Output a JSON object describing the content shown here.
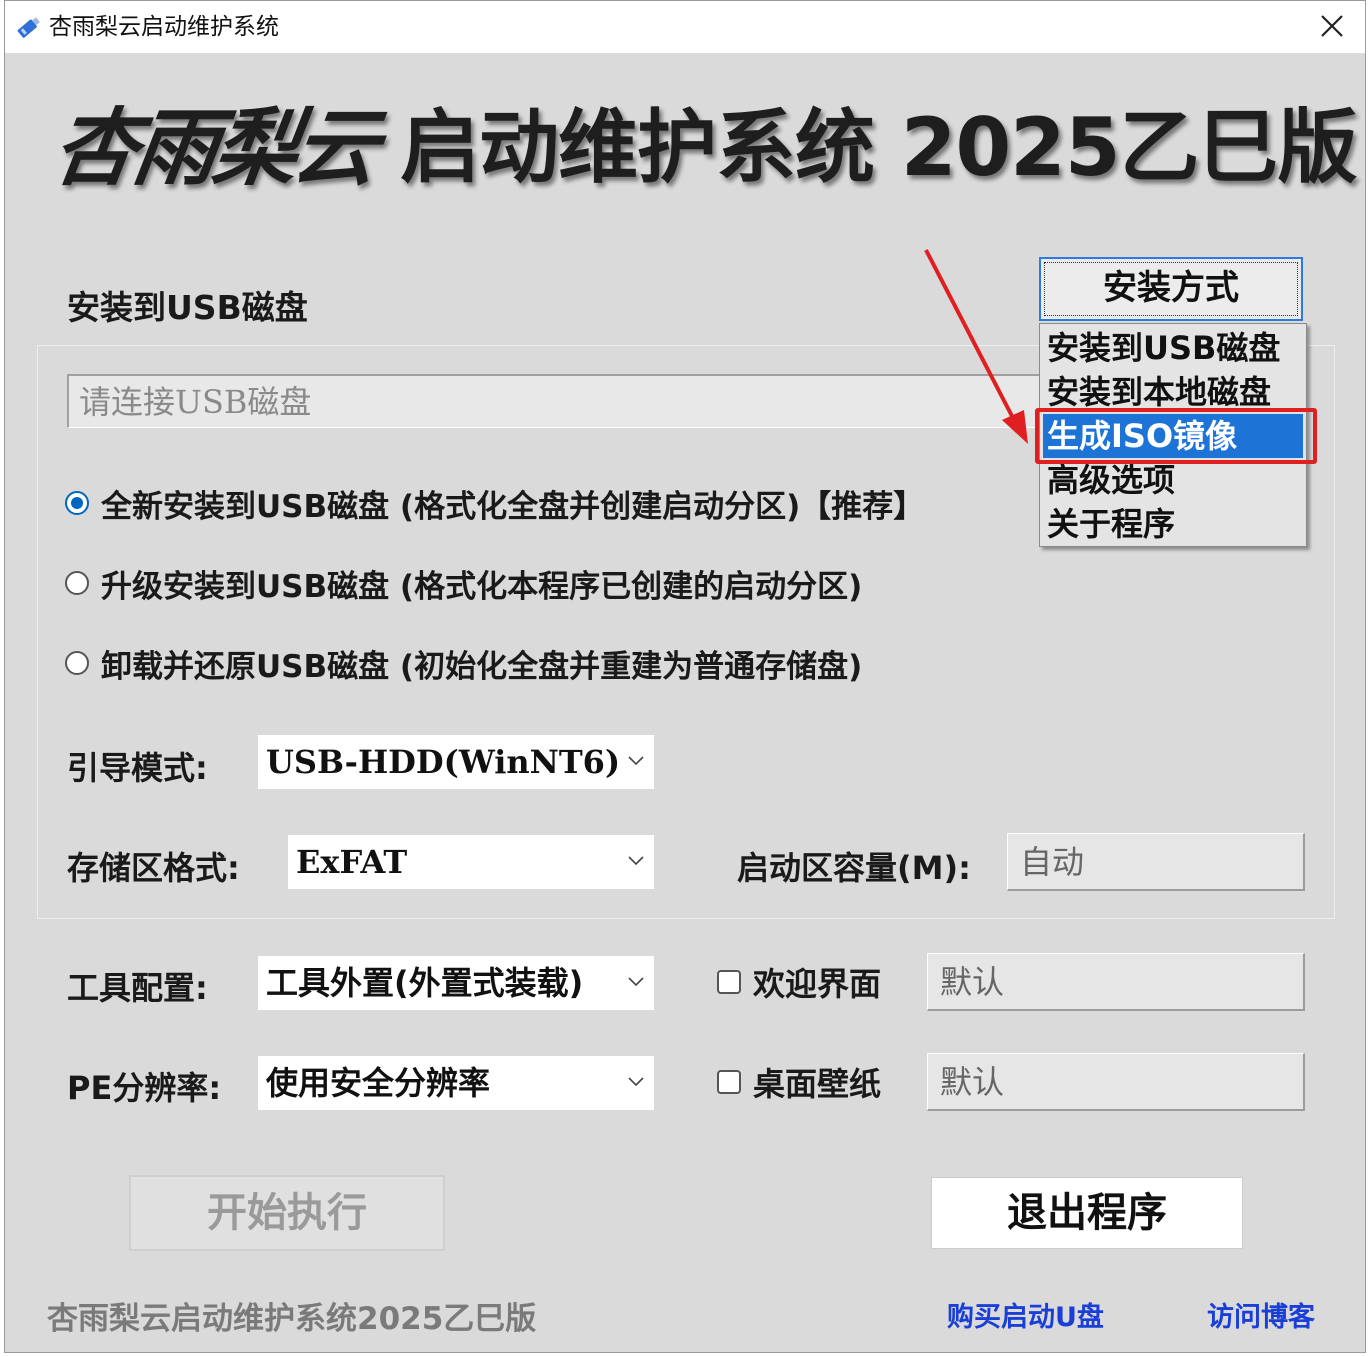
{
  "window": {
    "title": "杏雨梨云启动维护系统",
    "icon": "usb-drive-icon"
  },
  "banner": {
    "script_text": "杏雨梨云",
    "main_text": "启动维护系统 2025乙巳版"
  },
  "install_section": {
    "title": "安装到USB磁盘",
    "usb_placeholder": "请连接USB磁盘",
    "options": [
      {
        "label": "全新安装到USB磁盘 (格式化全盘并创建启动分区)【推荐】",
        "checked": true
      },
      {
        "label": "升级安装到USB磁盘 (格式化本程序已创建的启动分区)",
        "checked": false
      },
      {
        "label": "卸载并还原USB磁盘 (初始化全盘并重建为普通存储盘)",
        "checked": false
      }
    ],
    "boot_mode": {
      "label": "引导模式:",
      "value": "USB-HDD(WinNT6)"
    },
    "storage_format": {
      "label": "存储区格式:",
      "value": "ExFAT"
    },
    "boot_size": {
      "label": "启动区容量(M):",
      "value": "自动"
    }
  },
  "tools": {
    "label": "工具配置:",
    "value": "工具外置(外置式装载)",
    "welcome": {
      "label": "欢迎界面",
      "checked": false,
      "value": "默认"
    }
  },
  "pe_resolution": {
    "label": "PE分辨率:",
    "value": "使用安全分辨率",
    "wallpaper": {
      "label": "桌面壁纸",
      "checked": false,
      "value": "默认"
    }
  },
  "buttons": {
    "start": "开始执行",
    "exit": "退出程序"
  },
  "footer": {
    "text": "杏雨梨云启动维护系统2025乙巳版",
    "buy_link": "购买启动U盘",
    "blog_link": "访问博客"
  },
  "install_method": {
    "button": "安装方式",
    "menu": [
      {
        "label": "安装到USB磁盘",
        "selected": false
      },
      {
        "label": "安装到本地磁盘",
        "selected": false
      },
      {
        "label": "生成ISO镜像",
        "selected": true
      },
      {
        "label": "高级选项",
        "selected": false
      },
      {
        "label": "关于程序",
        "selected": false
      }
    ]
  },
  "colors": {
    "accent": "#1e74d6",
    "annotation": "#e02020",
    "link": "#1a3fd8",
    "window_bg": "#dadada"
  }
}
